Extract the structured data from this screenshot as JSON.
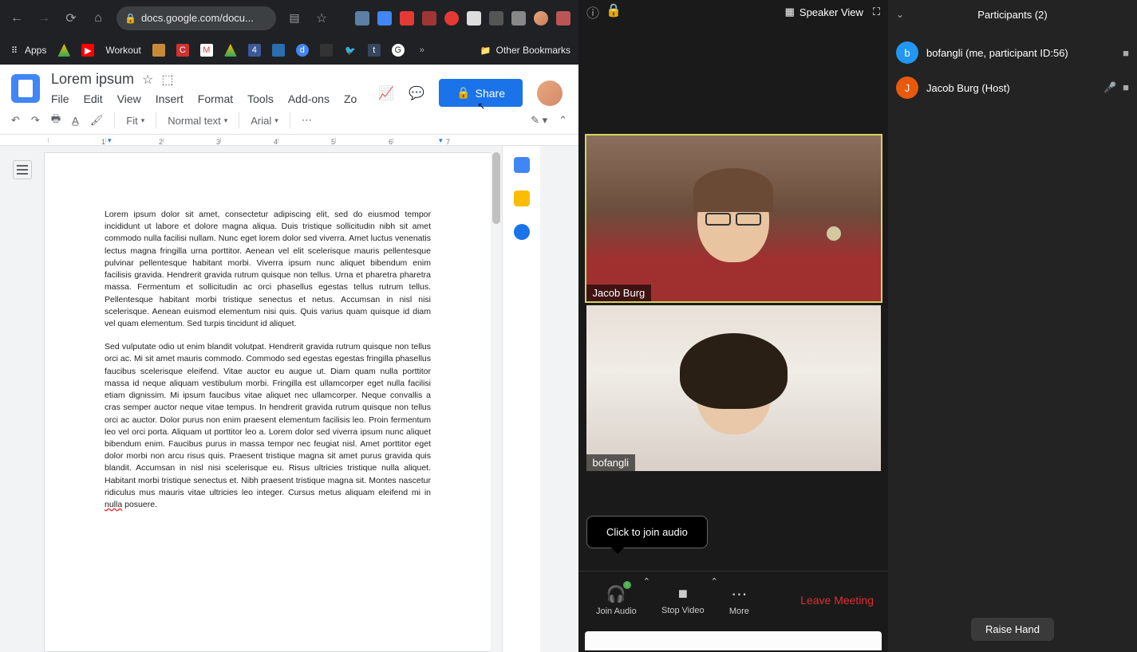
{
  "browser": {
    "url": "docs.google.com/docu...",
    "bookmarks": {
      "apps": "Apps",
      "workout": "Workout",
      "other": "Other Bookmarks"
    }
  },
  "docs": {
    "title": "Lorem ipsum",
    "menus": [
      "File",
      "Edit",
      "View",
      "Insert",
      "Format",
      "Tools",
      "Add-ons",
      "Zo"
    ],
    "share": "Share",
    "toolbar": {
      "fit": "Fit",
      "style": "Normal text",
      "font": "Arial"
    },
    "ruler": [
      "1",
      "2",
      "3",
      "4",
      "5",
      "6",
      "7"
    ],
    "para1": "Lorem ipsum dolor sit amet, consectetur adipiscing elit, sed do eiusmod tempor incididunt ut labore et dolore magna aliqua. Duis tristique sollicitudin nibh sit amet commodo nulla facilisi nullam. Nunc eget lorem dolor sed viverra. Amet luctus venenatis lectus magna fringilla urna porttitor. Aenean vel elit scelerisque mauris pellentesque pulvinar pellentesque habitant morbi. Viverra ipsum nunc aliquet bibendum enim facilisis gravida. Hendrerit gravida rutrum quisque non tellus. Urna et pharetra pharetra massa. Fermentum et sollicitudin ac orci phasellus egestas tellus rutrum tellus. Pellentesque habitant morbi tristique senectus et netus. Accumsan in nisl nisi scelerisque. Aenean euismod elementum nisi quis. Quis varius quam quisque id diam vel quam elementum. Sed turpis tincidunt id aliquet.",
    "para2a": "Sed vulputate odio ut enim blandit volutpat. Hendrerit gravida rutrum quisque non tellus orci ac. Mi sit amet mauris commodo. Commodo sed egestas egestas fringilla phasellus faucibus scelerisque eleifend. Vitae auctor eu augue ut. Diam quam nulla porttitor massa id neque aliquam vestibulum morbi. Fringilla est ullamcorper eget nulla facilisi etiam dignissim. Mi ipsum faucibus vitae aliquet nec ullamcorper. Neque convallis a cras semper auctor neque vitae tempus. In hendrerit gravida rutrum quisque non tellus orci ac auctor. Dolor purus non enim praesent elementum facilisis leo. Proin fermentum leo vel orci porta. Aliquam ut porttitor leo a. Lorem dolor sed viverra ipsum nunc aliquet bibendum enim. Faucibus purus in massa tempor nec feugiat nisl. Amet porttitor eget dolor morbi non arcu risus quis. Praesent tristique magna sit amet purus gravida quis blandit. Accumsan in nisl nisi scelerisque eu. Risus ultricies tristique nulla aliquet. Habitant morbi tristique senectus et. Nibh praesent tristique magna sit. Montes nascetur ridiculus mus mauris vitae ultricies leo integer. Cursus metus aliquam eleifend mi in ",
    "para2b": "nulla",
    "para2c": " posuere."
  },
  "zoom": {
    "speaker_view": "Speaker View",
    "tile1": "Jacob Burg",
    "tile2": "bofangli",
    "tooltip": "Click to join audio",
    "footer": {
      "join_audio": "Join Audio",
      "stop_video": "Stop Video",
      "more": "More",
      "leave": "Leave Meeting"
    }
  },
  "participants": {
    "title": "Participants (2)",
    "p1": "bofangli (me, participant ID:56)",
    "p2": "Jacob Burg (Host)",
    "raise": "Raise Hand"
  }
}
